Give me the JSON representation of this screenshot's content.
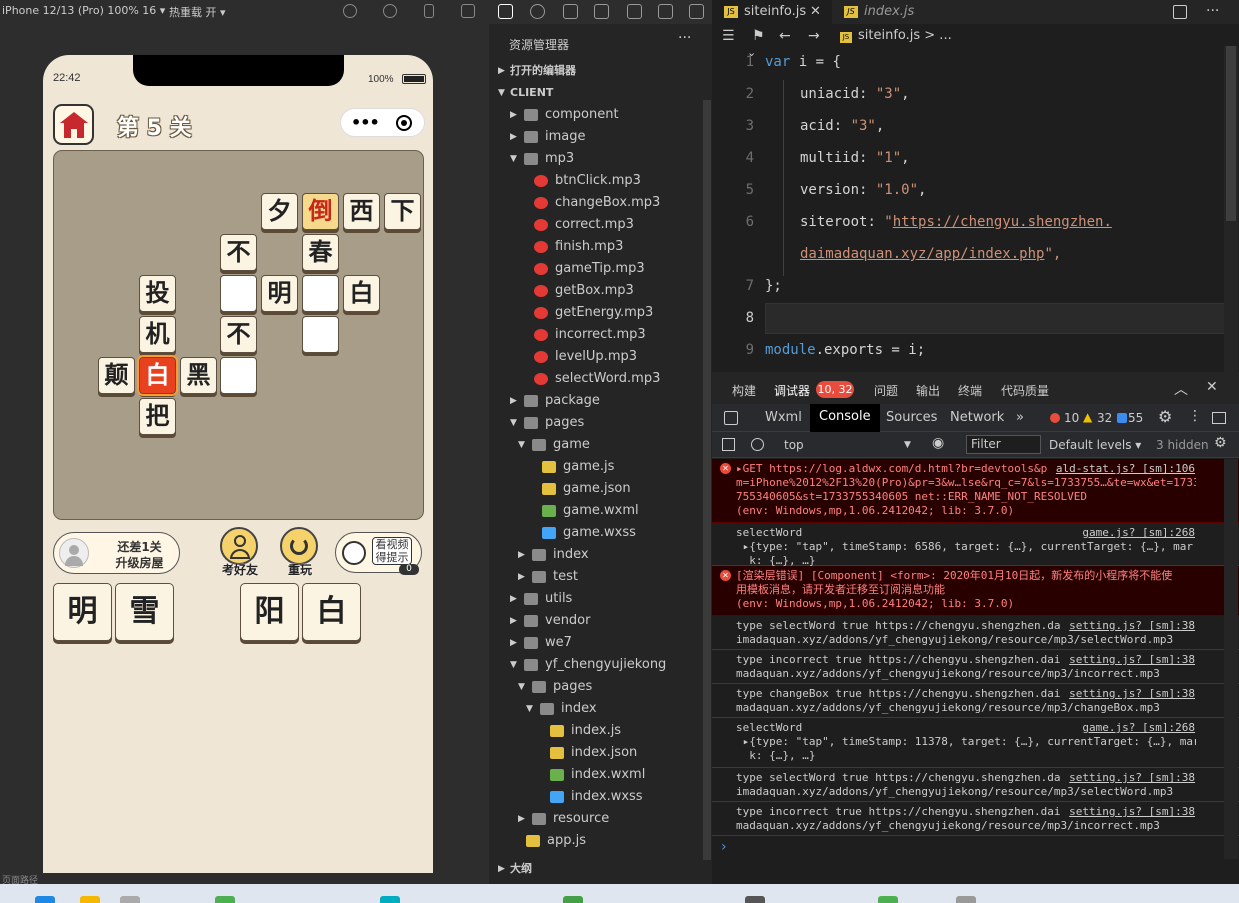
{
  "simulator": {
    "device": "iPhone 12/13 (Pro) 100% 16 ▾",
    "hot_reload": "热重载 开 ▾",
    "bottom_path": "页面路径"
  },
  "phone": {
    "time": "22:42",
    "battery": "100%",
    "level_title": "第 5 关",
    "capsule_dots": "•••",
    "board_cells": [
      {
        "ch": "夕",
        "s": "n"
      },
      {
        "ch": "倒",
        "s": "hl"
      },
      {
        "ch": "西",
        "s": "n"
      },
      {
        "ch": "下",
        "s": "n"
      },
      {
        "ch": "不",
        "s": "n"
      },
      {
        "ch": "春",
        "s": "n"
      },
      {
        "ch": "投",
        "s": "n"
      },
      {
        "ch": "",
        "s": "e"
      },
      {
        "ch": "明",
        "s": "n"
      },
      {
        "ch": "",
        "s": "e"
      },
      {
        "ch": "白",
        "s": "n"
      },
      {
        "ch": "机",
        "s": "n"
      },
      {
        "ch": "不",
        "s": "n"
      },
      {
        "ch": "",
        "s": "e"
      },
      {
        "ch": "颠",
        "s": "n"
      },
      {
        "ch": "白",
        "s": "sel"
      },
      {
        "ch": "黑",
        "s": "n"
      },
      {
        "ch": "",
        "s": "e"
      },
      {
        "ch": "把",
        "s": "n"
      }
    ],
    "hint_line1": "还差1关",
    "hint_line2": "升级房屋",
    "btn_friend": "考好友",
    "btn_replay": "重玩",
    "btn_watch": "看视频得提示",
    "watch_count": "0",
    "answer_cards": [
      "明",
      "雪",
      "阳",
      "白"
    ]
  },
  "explorer": {
    "title": "资源管理器",
    "more": "···",
    "open_editors": "打开的编辑器",
    "root": "CLIENT",
    "outline": "大纲",
    "items": [
      {
        "name": "component",
        "type": "folder",
        "open": false
      },
      {
        "name": "image",
        "type": "folder",
        "open": false
      },
      {
        "name": "mp3",
        "type": "folder",
        "open": true
      },
      {
        "name": "btnClick.mp3",
        "type": "mp3"
      },
      {
        "name": "changeBox.mp3",
        "type": "mp3"
      },
      {
        "name": "correct.mp3",
        "type": "mp3"
      },
      {
        "name": "finish.mp3",
        "type": "mp3"
      },
      {
        "name": "gameTip.mp3",
        "type": "mp3"
      },
      {
        "name": "getBox.mp3",
        "type": "mp3"
      },
      {
        "name": "getEnergy.mp3",
        "type": "mp3"
      },
      {
        "name": "incorrect.mp3",
        "type": "mp3"
      },
      {
        "name": "levelUp.mp3",
        "type": "mp3"
      },
      {
        "name": "selectWord.mp3",
        "type": "mp3"
      },
      {
        "name": "package",
        "type": "folder",
        "open": false
      },
      {
        "name": "pages",
        "type": "folder",
        "open": true
      },
      {
        "name": "game",
        "type": "folder",
        "open": true
      },
      {
        "name": "game.js",
        "type": "js"
      },
      {
        "name": "game.json",
        "type": "json"
      },
      {
        "name": "game.wxml",
        "type": "wxml"
      },
      {
        "name": "game.wxss",
        "type": "wxss"
      },
      {
        "name": "index",
        "type": "folder",
        "open": false
      },
      {
        "name": "test",
        "type": "folder",
        "open": false
      },
      {
        "name": "utils",
        "type": "folder",
        "open": false
      },
      {
        "name": "vendor",
        "type": "folder",
        "open": false
      },
      {
        "name": "we7",
        "type": "folder",
        "open": false
      },
      {
        "name": "yf_chengyujiekong",
        "type": "folder",
        "open": true
      },
      {
        "name": "pages",
        "type": "folder",
        "open": true
      },
      {
        "name": "index",
        "type": "folder",
        "open": true
      },
      {
        "name": "index.js",
        "type": "js"
      },
      {
        "name": "index.json",
        "type": "json"
      },
      {
        "name": "index.wxml",
        "type": "wxml"
      },
      {
        "name": "index.wxss",
        "type": "wxss"
      },
      {
        "name": "resource",
        "type": "folder",
        "open": false
      },
      {
        "name": "app.js",
        "type": "js"
      }
    ]
  },
  "editor": {
    "tab_active": "siteinfo.js",
    "tab_close": "✕",
    "tab_other": "index.js",
    "breadcrumb": "siteinfo.js > ...",
    "lines": [
      "1",
      "2",
      "3",
      "4",
      "5",
      "6",
      "",
      "7",
      "8",
      "9"
    ],
    "code": {
      "l1_kw": "var",
      "l1_rest": " i = {",
      "k_uniacid": "uniacid",
      "v_uniacid": "\"3\"",
      "k_acid": "acid",
      "v_acid": "\"3\"",
      "k_multiid": "multiid",
      "v_multiid": "\"1\"",
      "k_version": "version",
      "v_version": "\"1.0\"",
      "k_siteroot": "siteroot",
      "v_siteroot_a": "\"",
      "v_siteroot_b": "https://chengyu.shengzhen.",
      "v_siteroot_c": "daimadaquan.xyz/app/index.php",
      "v_siteroot_d": "\",",
      "l7": "};",
      "l9_mod": "module",
      "l9_rest": ".exports = i;"
    }
  },
  "debugger": {
    "tabs": [
      "构建",
      "调试器",
      "问题",
      "输出",
      "终端",
      "代码质量"
    ],
    "badge": "10, 32",
    "devtools_tabs": [
      "Wxml",
      "Console",
      "Sources",
      "Network",
      "»"
    ],
    "err_count": "10",
    "warn_count": "32",
    "info_count": "55",
    "context": "top",
    "filter_placeholder": "Filter",
    "levels": "Default levels ▾",
    "hidden": "3 hidden",
    "prompt": "›",
    "messages": [
      {
        "err": true,
        "text": "▸GET https://log.aldwx.com/d.html?br=devtools&p\nm=iPhone%2012%2F13%20(Pro)&pr=3&w…lse&rq_c=7&ls=1733755…&te=wx&et=1733\n755340605&st=1733755340605 net::ERR_NAME_NOT_RESOLVED\n(env: Windows,mp,1.06.2412042; lib: 3.7.0)",
        "src": "ald-stat.js? [sm]:106"
      },
      {
        "err": false,
        "text": "selectWord\n ▸{type: \"tap\", timeStamp: 6586, target: {…}, currentTarget: {…}, mar\n  k: {…}, …}",
        "src": "game.js? [sm]:268"
      },
      {
        "err": true,
        "text": "[渲染层错误] [Component] <form>: 2020年01月10日起，新发布的小程序将不能使\n用模板消息，请开发者迁移至订阅消息功能\n(env: Windows,mp,1.06.2412042; lib: 3.7.0)",
        "src": ""
      },
      {
        "err": false,
        "text": "type selectWord true https://chengyu.shengzhen.da\nimadaquan.xyz/addons/yf_chengyujiekong/resource/mp3/selectWord.mp3",
        "src": "setting.js? [sm]:38"
      },
      {
        "err": false,
        "text": "type incorrect true https://chengyu.shengzhen.dai\nmadaquan.xyz/addons/yf_chengyujiekong/resource/mp3/incorrect.mp3",
        "src": "setting.js? [sm]:38"
      },
      {
        "err": false,
        "text": "type changeBox true https://chengyu.shengzhen.dai\nmadaquan.xyz/addons/yf_chengyujiekong/resource/mp3/changeBox.mp3",
        "src": "setting.js? [sm]:38"
      },
      {
        "err": false,
        "text": "selectWord\n ▸{type: \"tap\", timeStamp: 11378, target: {…}, currentTarget: {…}, mar\n  k: {…}, …}",
        "src": "game.js? [sm]:268"
      },
      {
        "err": false,
        "text": "type selectWord true https://chengyu.shengzhen.da\nimadaquan.xyz/addons/yf_chengyujiekong/resource/mp3/selectWord.mp3",
        "src": "setting.js? [sm]:38"
      },
      {
        "err": false,
        "text": "type incorrect true https://chengyu.shengzhen.dai\nmadaquan.xyz/addons/yf_chengyujiekong/resource/mp3/incorrect.mp3",
        "src": "setting.js? [sm]:38"
      }
    ]
  }
}
